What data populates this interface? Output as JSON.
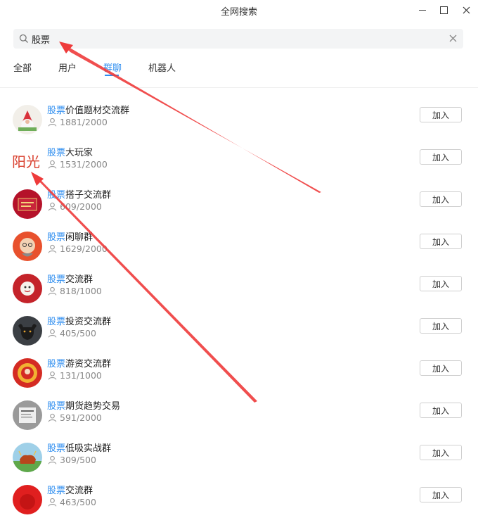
{
  "window": {
    "title": "全网搜索"
  },
  "search": {
    "value": "股票",
    "placeholder": ""
  },
  "tabs": [
    {
      "label": "全部",
      "active": false
    },
    {
      "label": "用户",
      "active": false
    },
    {
      "label": "群聊",
      "active": true
    },
    {
      "label": "机器人",
      "active": false
    }
  ],
  "join_label": "加入",
  "groups": [
    {
      "keyword": "股票",
      "rest": "价值题材交流群",
      "members": "1881/2000",
      "avatar": "christmas-gnome"
    },
    {
      "keyword": "股票",
      "rest": "大玩家",
      "members": "1531/2000",
      "avatar": "text-yangguang",
      "avatar_text": "阳光"
    },
    {
      "keyword": "股票",
      "rest": "搭子交流群",
      "members": "609/2000",
      "avatar": "red-card"
    },
    {
      "keyword": "股票",
      "rest": "闲聊群",
      "members": "1629/2000",
      "avatar": "cartoon-elder"
    },
    {
      "keyword": "股票",
      "rest": "交流群",
      "members": "818/1000",
      "avatar": "red-mascot"
    },
    {
      "keyword": "股票",
      "rest": "投资交流群",
      "members": "405/500",
      "avatar": "bull"
    },
    {
      "keyword": "股票",
      "rest": "游资交流群",
      "members": "131/1000",
      "avatar": "red-festive"
    },
    {
      "keyword": "股票",
      "rest": "期货趋势交易",
      "members": "591/2000",
      "avatar": "grey-paper"
    },
    {
      "keyword": "股票",
      "rest": "低吸实战群",
      "members": "309/500",
      "avatar": "bull-green"
    },
    {
      "keyword": "股票",
      "rest": "交流群",
      "members": "463/500",
      "avatar": "red-round"
    }
  ],
  "colors": {
    "accent": "#2e8ef0",
    "annotation": "#ee3b3b"
  }
}
